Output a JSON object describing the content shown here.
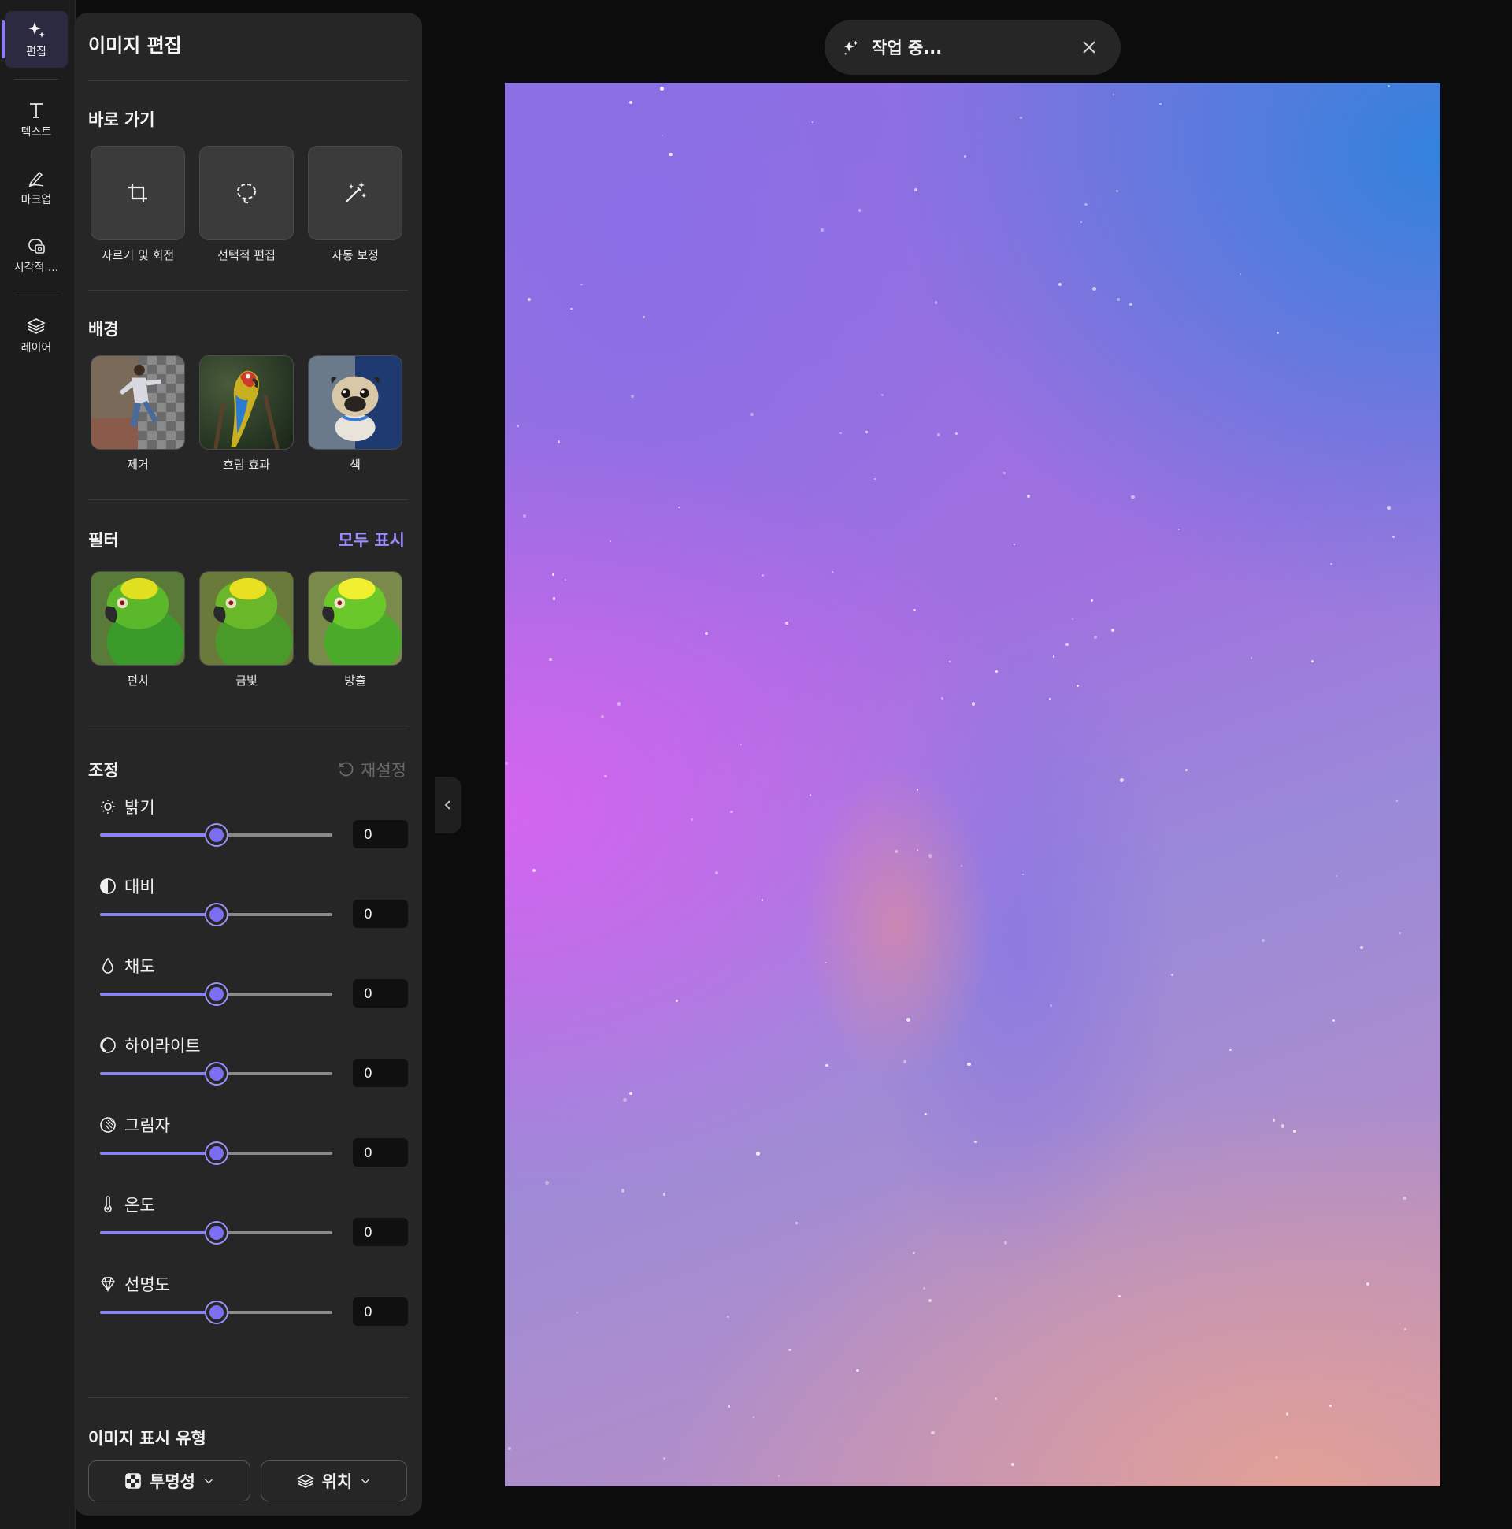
{
  "rail": {
    "items": [
      {
        "label": "편집",
        "icon": "sparkle-icon"
      },
      {
        "label": "텍스트",
        "icon": "text-icon"
      },
      {
        "label": "마크업",
        "icon": "pen-icon"
      },
      {
        "label": "시각적 ...",
        "icon": "visual-search-icon"
      },
      {
        "label": "레이어",
        "icon": "layers-icon"
      }
    ]
  },
  "panel": {
    "title": "이미지 편집",
    "quick": {
      "title": "바로 가기",
      "items": [
        {
          "label": "자르기 및 회전",
          "icon": "crop-icon"
        },
        {
          "label": "선택적 편집",
          "icon": "lasso-icon"
        },
        {
          "label": "자동 보정",
          "icon": "magic-wand-icon"
        }
      ]
    },
    "background": {
      "title": "배경",
      "items": [
        {
          "label": "제거"
        },
        {
          "label": "흐림 효과"
        },
        {
          "label": "색"
        }
      ]
    },
    "filters": {
      "title": "필터",
      "show_all": "모두 표시",
      "items": [
        {
          "label": "펀치"
        },
        {
          "label": "금빛"
        },
        {
          "label": "방출"
        }
      ]
    },
    "adjust": {
      "title": "조정",
      "reset": "재설정",
      "items": [
        {
          "label": "밝기",
          "icon": "sun-icon",
          "value": "0",
          "level": 0.5
        },
        {
          "label": "대비",
          "icon": "contrast-icon",
          "value": "0",
          "level": 0.5
        },
        {
          "label": "채도",
          "icon": "drop-icon",
          "value": "0",
          "level": 0.5
        },
        {
          "label": "하이라이트",
          "icon": "highlight-icon",
          "value": "0",
          "level": 0.5
        },
        {
          "label": "그림자",
          "icon": "shadow-icon",
          "value": "0",
          "level": 0.5
        },
        {
          "label": "온도",
          "icon": "thermometer-icon",
          "value": "0",
          "level": 0.5
        },
        {
          "label": "선명도",
          "icon": "diamond-icon",
          "value": "0",
          "level": 0.5
        }
      ]
    },
    "display": {
      "title": "이미지 표시 유형",
      "transparency": "투명성",
      "position": "위치"
    }
  },
  "toast": {
    "text": "작업 중..."
  },
  "colors": {
    "accent": "#8b7cf6",
    "panel": "#262626",
    "rail": "#1c1c1c",
    "background": "#0c0c0c"
  }
}
